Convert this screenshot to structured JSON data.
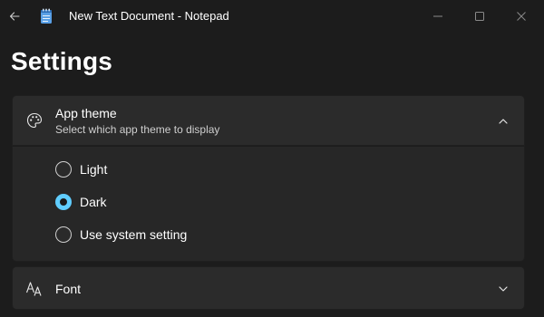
{
  "window": {
    "title": "New Text Document - Notepad"
  },
  "icons": {
    "back": "back-arrow-icon",
    "app": "notepad-icon",
    "minimize": "minimize-icon",
    "maximize": "maximize-icon",
    "close": "close-icon",
    "theme": "palette-icon",
    "font": "font-icon",
    "expand": "chevron-down-icon",
    "collapse": "chevron-up-icon"
  },
  "colors": {
    "background": "#1c1c1c",
    "card": "#2b2b2b",
    "accent": "#60cdff"
  },
  "page": {
    "title": "Settings"
  },
  "app_theme": {
    "title": "App theme",
    "subtitle": "Select which app theme to display",
    "expanded": true,
    "options": [
      {
        "label": "Light",
        "selected": false
      },
      {
        "label": "Dark",
        "selected": true
      },
      {
        "label": "Use system setting",
        "selected": false
      }
    ]
  },
  "font": {
    "title": "Font",
    "expanded": false
  }
}
